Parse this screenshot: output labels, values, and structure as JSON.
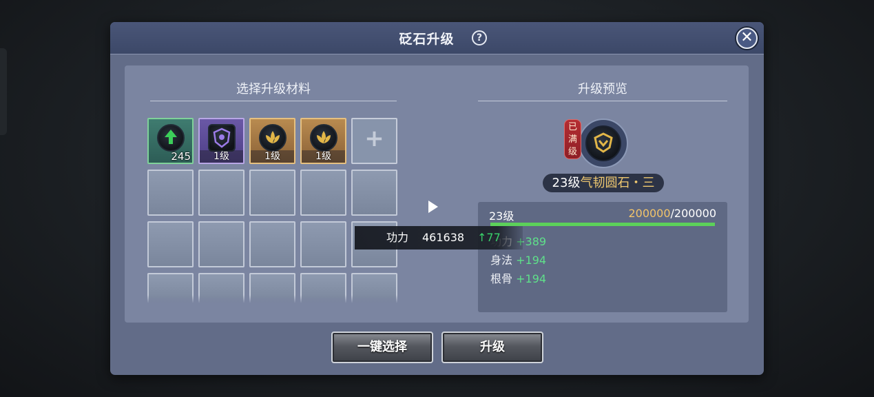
{
  "dialog": {
    "title": "砭石升级",
    "help_label": "?",
    "close_label": "✕"
  },
  "materials": {
    "title": "选择升级材料",
    "slots": [
      {
        "label": "245",
        "kind": "green",
        "icon": "green-arrow-gem-icon"
      },
      {
        "label": "1级",
        "kind": "purple",
        "icon": "purple-shield-gem-icon"
      },
      {
        "label": "1级",
        "kind": "orange",
        "icon": "gold-lotus-gem-icon"
      },
      {
        "label": "1级",
        "kind": "orange",
        "icon": "gold-lotus-gem-icon"
      }
    ],
    "add_label": "+"
  },
  "tooltip": {
    "key": "功力",
    "value": "461638",
    "increase": "77",
    "arrow": "↑"
  },
  "preview": {
    "title": "升级预览",
    "max_tag": "已满级",
    "gem_icon": "gold-crown-gem-icon",
    "gem_level": "23级",
    "gem_name": "气韧圆石・三",
    "level_label": "23级",
    "exp_current": "200000",
    "exp_max": "/200000",
    "exp_fraction": 1.0,
    "stats": [
      {
        "name": "功力",
        "value": "+389"
      },
      {
        "name": "身法",
        "value": "+194"
      },
      {
        "name": "根骨",
        "value": "+194"
      }
    ]
  },
  "buttons": {
    "auto_select": "一键选择",
    "upgrade": "升级"
  },
  "colors": {
    "exp_bar": "#5cd15a",
    "stat_value": "#5fe08a",
    "exp_current": "#f2c46a",
    "max_tag": "#b52d32"
  }
}
